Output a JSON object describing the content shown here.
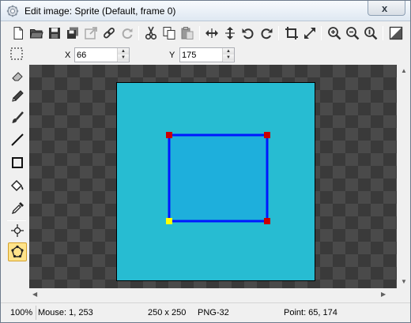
{
  "window": {
    "title": "Edit image: Sprite (Default, frame 0)",
    "close_symbol": "x"
  },
  "toolbar": {
    "buttons": [
      {
        "name": "new-icon"
      },
      {
        "name": "open-icon"
      },
      {
        "name": "save-icon"
      },
      {
        "name": "save-all-icon"
      },
      {
        "name": "export-icon"
      },
      {
        "name": "link-icon"
      },
      {
        "name": "refresh-icon"
      },
      {
        "name": "cut-icon"
      },
      {
        "name": "copy-icon"
      },
      {
        "name": "paste-icon"
      },
      {
        "name": "flip-horizontal-icon"
      },
      {
        "name": "flip-vertical-icon"
      },
      {
        "name": "rotate-left-icon"
      },
      {
        "name": "rotate-right-icon"
      },
      {
        "name": "crop-icon"
      },
      {
        "name": "resize-icon"
      },
      {
        "name": "zoom-in-icon"
      },
      {
        "name": "zoom-out-icon"
      },
      {
        "name": "zoom-reset-icon"
      },
      {
        "name": "image-settings-icon"
      }
    ]
  },
  "coords": {
    "x_label": "X",
    "x_value": "66",
    "y_label": "Y",
    "y_value": "175"
  },
  "tools": [
    {
      "name": "eraser-icon",
      "active": false
    },
    {
      "name": "pencil-icon",
      "active": false
    },
    {
      "name": "brush-icon",
      "active": false
    },
    {
      "name": "line-icon",
      "active": false
    },
    {
      "name": "rectangle-icon",
      "active": false
    },
    {
      "name": "fill-icon",
      "active": false
    },
    {
      "name": "color-picker-icon",
      "active": false
    },
    {
      "name": "origin-icon",
      "active": false
    },
    {
      "name": "mask-polygon-icon",
      "active": true
    }
  ],
  "image": {
    "background_color": "#27bcd2",
    "mask_fill": "#1eafdc",
    "mask_stroke": "#0018ff",
    "point_color": "#cc0000",
    "selected_point_color": "#ffff00"
  },
  "status": {
    "zoom": "100%",
    "mouse": "Mouse: 1, 253",
    "size": "250 x 250",
    "format": "PNG-32",
    "point": "Point: 65, 174"
  }
}
